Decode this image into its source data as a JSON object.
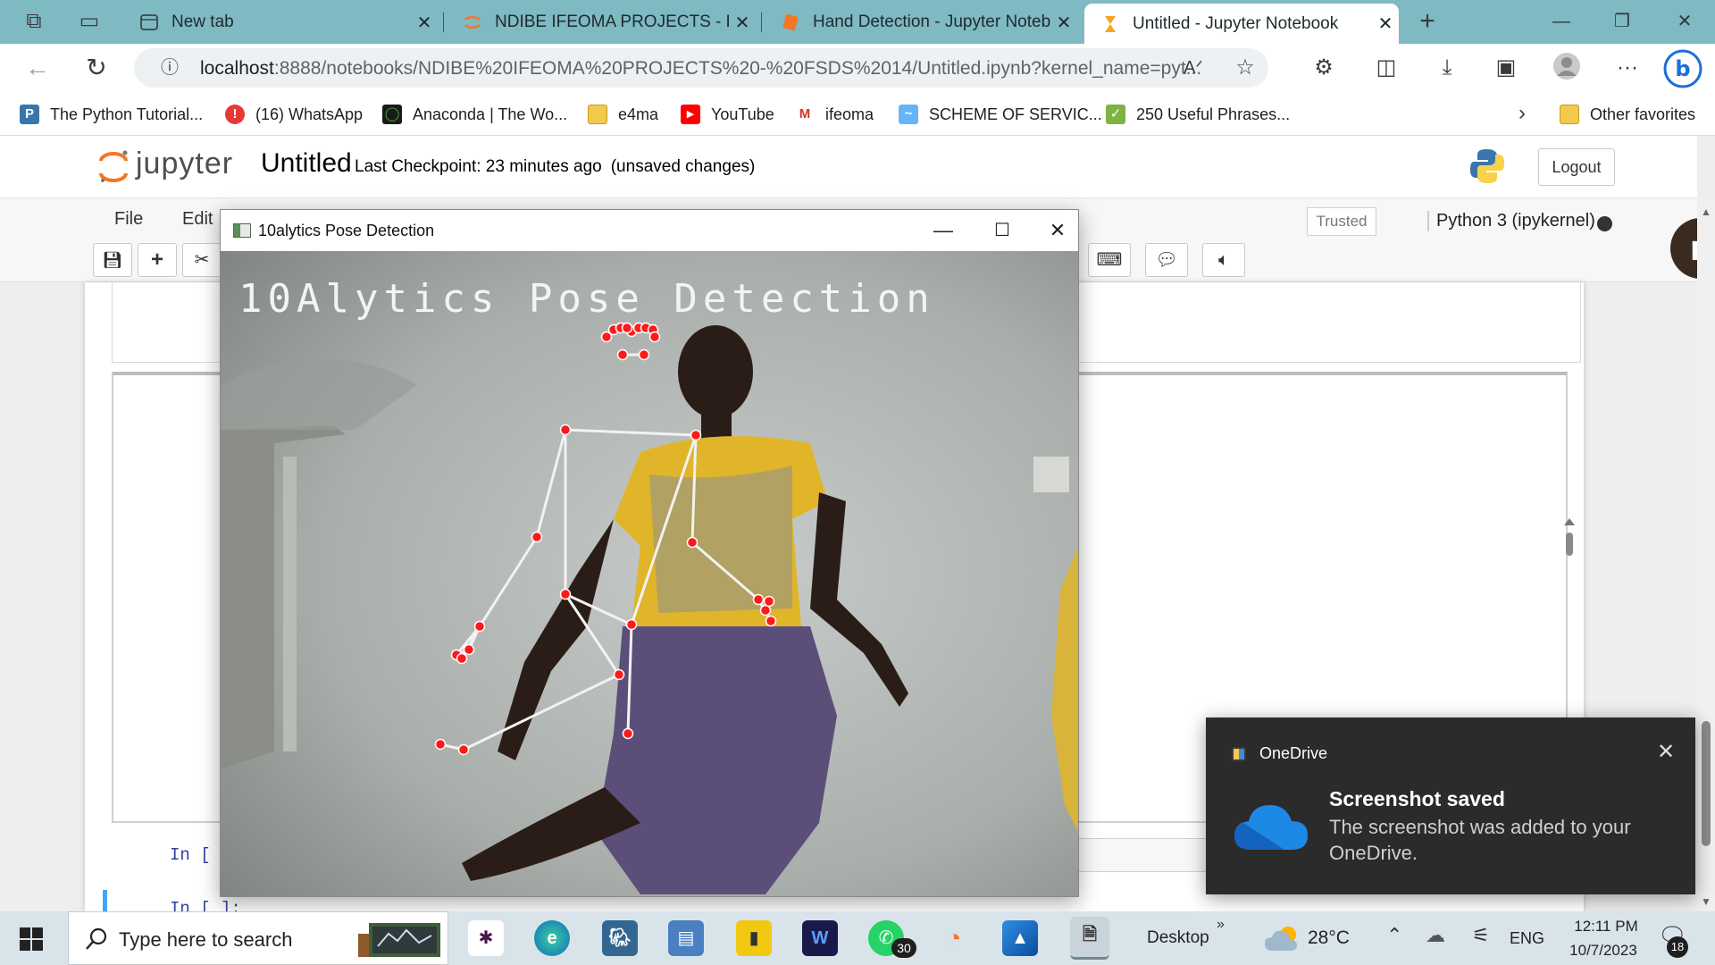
{
  "browser": {
    "tabs": [
      {
        "title": "New tab",
        "icon": "new-tab-icon"
      },
      {
        "title": "NDIBE IFEOMA PROJECTS - FSDS",
        "icon": "jupyter-icon"
      },
      {
        "title": "Hand Detection - Jupyter Notebo",
        "icon": "jupyter-notebook-icon"
      },
      {
        "title": "Untitled - Jupyter Notebook",
        "icon": "hourglass-icon"
      }
    ],
    "url_host": "localhost",
    "url_rest": ":8888/notebooks/NDIBE%20IFEOMA%20PROJECTS%20-%20FSDS%2014/Untitled.ipynb?kernel_name=pyt...",
    "favorites": [
      {
        "label": "The Python Tutorial...",
        "color": "#3776ab",
        "glyph": "P"
      },
      {
        "label": "(16) WhatsApp",
        "color": "#e53935",
        "glyph": "!"
      },
      {
        "label": "Anaconda | The Wo...",
        "color": "#1a1a1a",
        "glyph": "◯"
      },
      {
        "label": "e4ma",
        "color": "#f2c94c",
        "glyph": ""
      },
      {
        "label": "YouTube",
        "color": "#ff0000",
        "glyph": "▶"
      },
      {
        "label": "ifeoma",
        "color": "#ffffff",
        "glyph": "M"
      },
      {
        "label": "SCHEME OF SERVIC...",
        "color": "#64b5f6",
        "glyph": "~"
      },
      {
        "label": "250 Useful Phrases...",
        "color": "#7cb342",
        "glyph": "✓"
      }
    ],
    "other_favorites": "Other favorites"
  },
  "jupyter": {
    "logo": "jupyter",
    "title": "Untitled",
    "checkpoint": "Last Checkpoint: 23 minutes ago",
    "unsaved": "(unsaved changes)",
    "logout": "Logout",
    "menu": [
      "File",
      "Edit"
    ],
    "trusted": "Trusted",
    "kernel": "Python 3 (ipykernel)",
    "avatar_letter": "r",
    "prompt1": "In [",
    "prompt2": "In [ ]:"
  },
  "cv_window": {
    "title": "10alytics Pose Detection",
    "overlay": "10Alytics Pose Detection",
    "landmark_color": "#ff1a1a",
    "connection_color": "#f2f2f2"
  },
  "toast": {
    "app": "OneDrive",
    "title": "Screenshot saved",
    "body": "The screenshot was added to your OneDrive."
  },
  "taskbar": {
    "search_placeholder": "Type here to search",
    "desktop": "Desktop",
    "temperature": "28°C",
    "language": "ENG",
    "time": "12:11 PM",
    "date": "10/7/2023",
    "notifications": "18",
    "whatsapp_badge": "30"
  }
}
